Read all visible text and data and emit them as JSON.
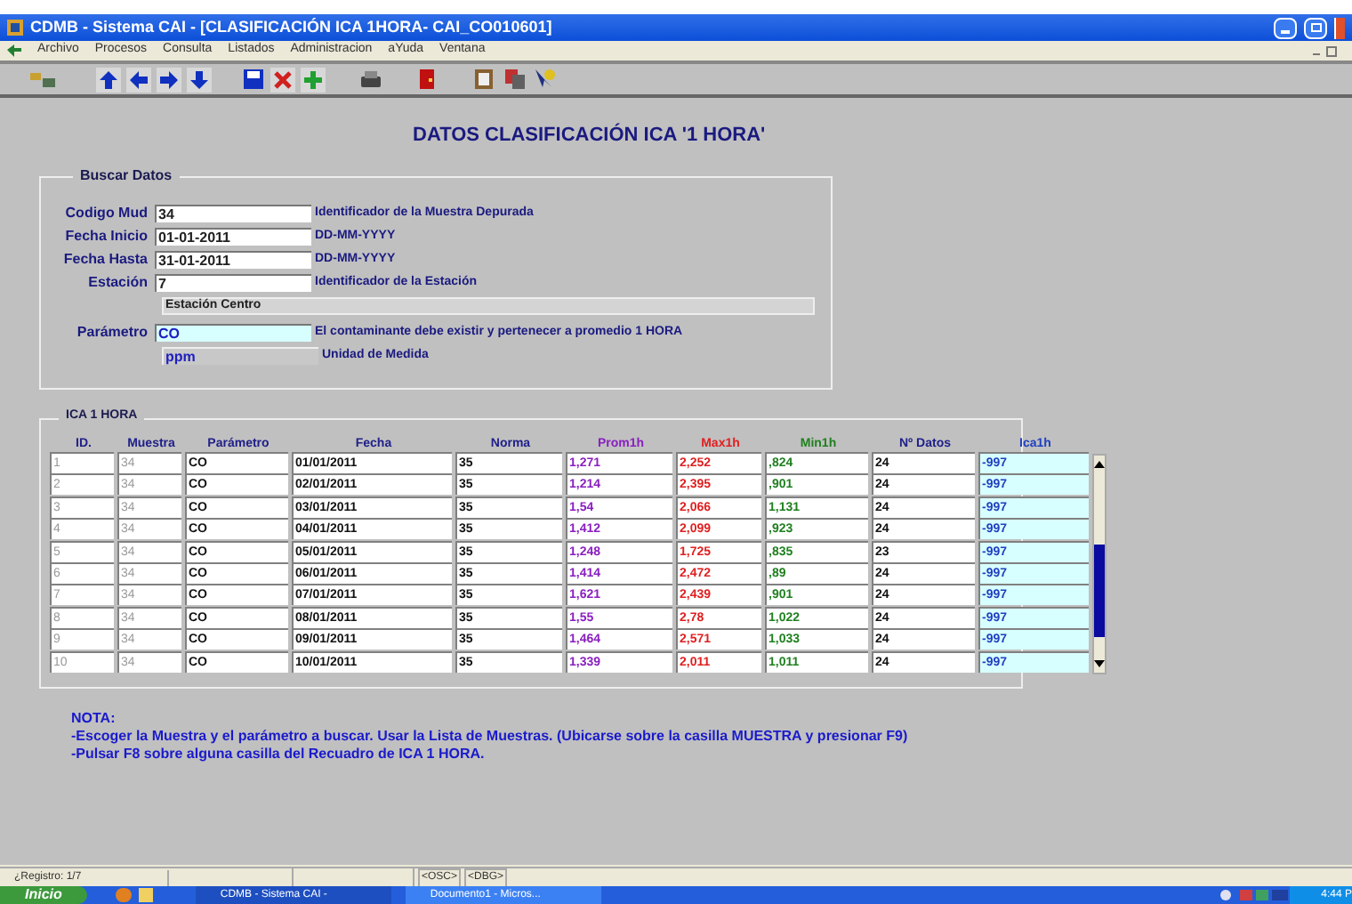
{
  "window": {
    "title": "CDMB - Sistema CAI - [CLASIFICACIÓN ICA 1HORA- CAI_CO010601]"
  },
  "menu": [
    "Archivo",
    "Procesos",
    "Consulta",
    "Listados",
    "Administracion",
    "aYuda",
    "Ventana"
  ],
  "heading": "DATOS CLASIFICACIÓN ICA '1 HORA'",
  "search": {
    "title": "Buscar Datos",
    "fields": [
      {
        "label": "Codigo Mud",
        "value": "34",
        "hint": "Identificador de la Muestra Depurada"
      },
      {
        "label": "Fecha Inicio",
        "value": "01-01-2011",
        "hint": "DD-MM-YYYY"
      },
      {
        "label": "Fecha Hasta",
        "value": "31-01-2011",
        "hint": "DD-MM-YYYY"
      },
      {
        "label": "Estación",
        "value": "7",
        "hint": "Identificador de la Estación"
      }
    ],
    "station_name": "Estación Centro",
    "parameter": {
      "label": "Parámetro",
      "value": "CO",
      "hint": "El contaminante debe existir y pertenecer a promedio 1 HORA"
    },
    "unit": {
      "value": "ppm",
      "hint": "Unidad de Medida"
    }
  },
  "table": {
    "title": "ICA 1 HORA",
    "columns": [
      "ID.",
      "Muestra",
      "Parámetro",
      "Fecha",
      "Norma",
      "Prom1h",
      "Max1h",
      "Min1h",
      "Nº Datos",
      "Ica1h"
    ],
    "rows": [
      [
        "1",
        "34",
        "CO",
        "01/01/2011",
        "35",
        "1,271",
        "2,252",
        ",824",
        "24",
        "-997"
      ],
      [
        "2",
        "34",
        "CO",
        "02/01/2011",
        "35",
        "1,214",
        "2,395",
        ",901",
        "24",
        "-997"
      ],
      [
        "3",
        "34",
        "CO",
        "03/01/2011",
        "35",
        "1,54",
        "2,066",
        "1,131",
        "24",
        "-997"
      ],
      [
        "4",
        "34",
        "CO",
        "04/01/2011",
        "35",
        "1,412",
        "2,099",
        ",923",
        "24",
        "-997"
      ],
      [
        "5",
        "34",
        "CO",
        "05/01/2011",
        "35",
        "1,248",
        "1,725",
        ",835",
        "23",
        "-997"
      ],
      [
        "6",
        "34",
        "CO",
        "06/01/2011",
        "35",
        "1,414",
        "2,472",
        ",89",
        "24",
        "-997"
      ],
      [
        "7",
        "34",
        "CO",
        "07/01/2011",
        "35",
        "1,621",
        "2,439",
        ",901",
        "24",
        "-997"
      ],
      [
        "8",
        "34",
        "CO",
        "08/01/2011",
        "35",
        "1,55",
        "2,78",
        "1,022",
        "24",
        "-997"
      ],
      [
        "9",
        "34",
        "CO",
        "09/01/2011",
        "35",
        "1,464",
        "2,571",
        "1,033",
        "24",
        "-997"
      ],
      [
        "10",
        "34",
        "CO",
        "10/01/2011",
        "35",
        "1,339",
        "2,011",
        "1,011",
        "24",
        "-997"
      ]
    ]
  },
  "note": {
    "title": "NOTA:",
    "lines": [
      "-Escoger la Muestra y el parámetro a buscar. Usar la Lista de Muestras. (Ubicarse sobre la casilla MUESTRA y presionar F9)",
      "-Pulsar F8 sobre alguna casilla del Recuadro de ICA 1 HORA."
    ]
  },
  "status_bar": {
    "record": "¿Registro: 1/7",
    "flags": [
      "<OSC>",
      "<DBG>"
    ]
  },
  "taskbar": {
    "start": "Inicio",
    "tasks": [
      "CDMB - Sistema CAI -",
      "Documento1 - Micros..."
    ],
    "clock": "4:44 P"
  }
}
